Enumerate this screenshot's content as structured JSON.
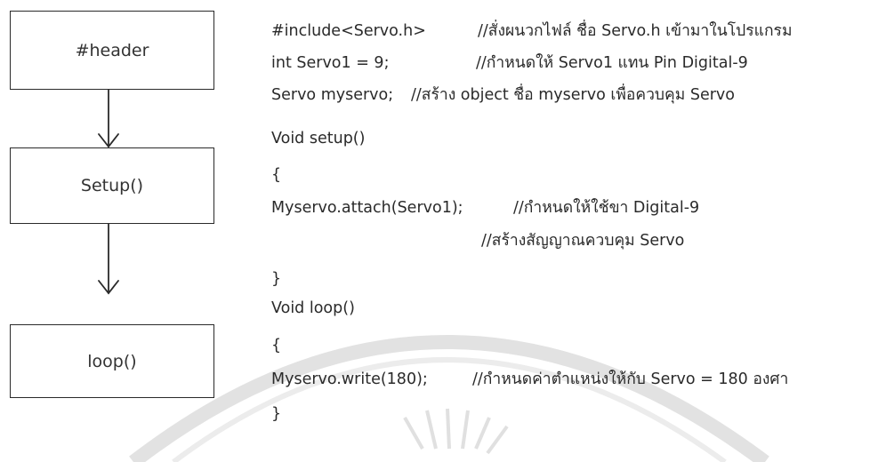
{
  "flowchart": {
    "header_label": "#header",
    "setup_label": "Setup()",
    "loop_label": "loop()"
  },
  "code": [
    {
      "code": "#include<Servo.h>",
      "comment": "//สั่งผนวกไฟล์ ชื่อ Servo.h เข้ามาในโปรแกรม"
    },
    {
      "code": "int Servo1 = 9;",
      "comment": "//กำหนดให้ Servo1 แทน Pin Digital-9"
    },
    {
      "code": "Servo myservo;",
      "comment": "//สร้าง object ชื่อ myservo เพื่อควบคุม Servo"
    },
    {
      "code": "Void setup()",
      "comment": ""
    },
    {
      "code": "{",
      "comment": ""
    },
    {
      "code": "Myservo.attach(Servo1);",
      "comment": "//กำหนดให้ใช้ขา Digital-9"
    },
    {
      "code": "",
      "comment": "//สร้างสัญญาณควบคุม Servo"
    },
    {
      "code": "}",
      "comment": ""
    },
    {
      "code": "Void loop()",
      "comment": ""
    },
    {
      "code": "{",
      "comment": ""
    },
    {
      "code": "Myservo.write(180);",
      "comment": "//กำหนดค่าตำแหน่งให้กับ Servo = 180 องศา"
    },
    {
      "code": "}",
      "comment": ""
    }
  ],
  "colors": {
    "text": "#2a2a2a",
    "watermark": "#d9d9d9"
  }
}
